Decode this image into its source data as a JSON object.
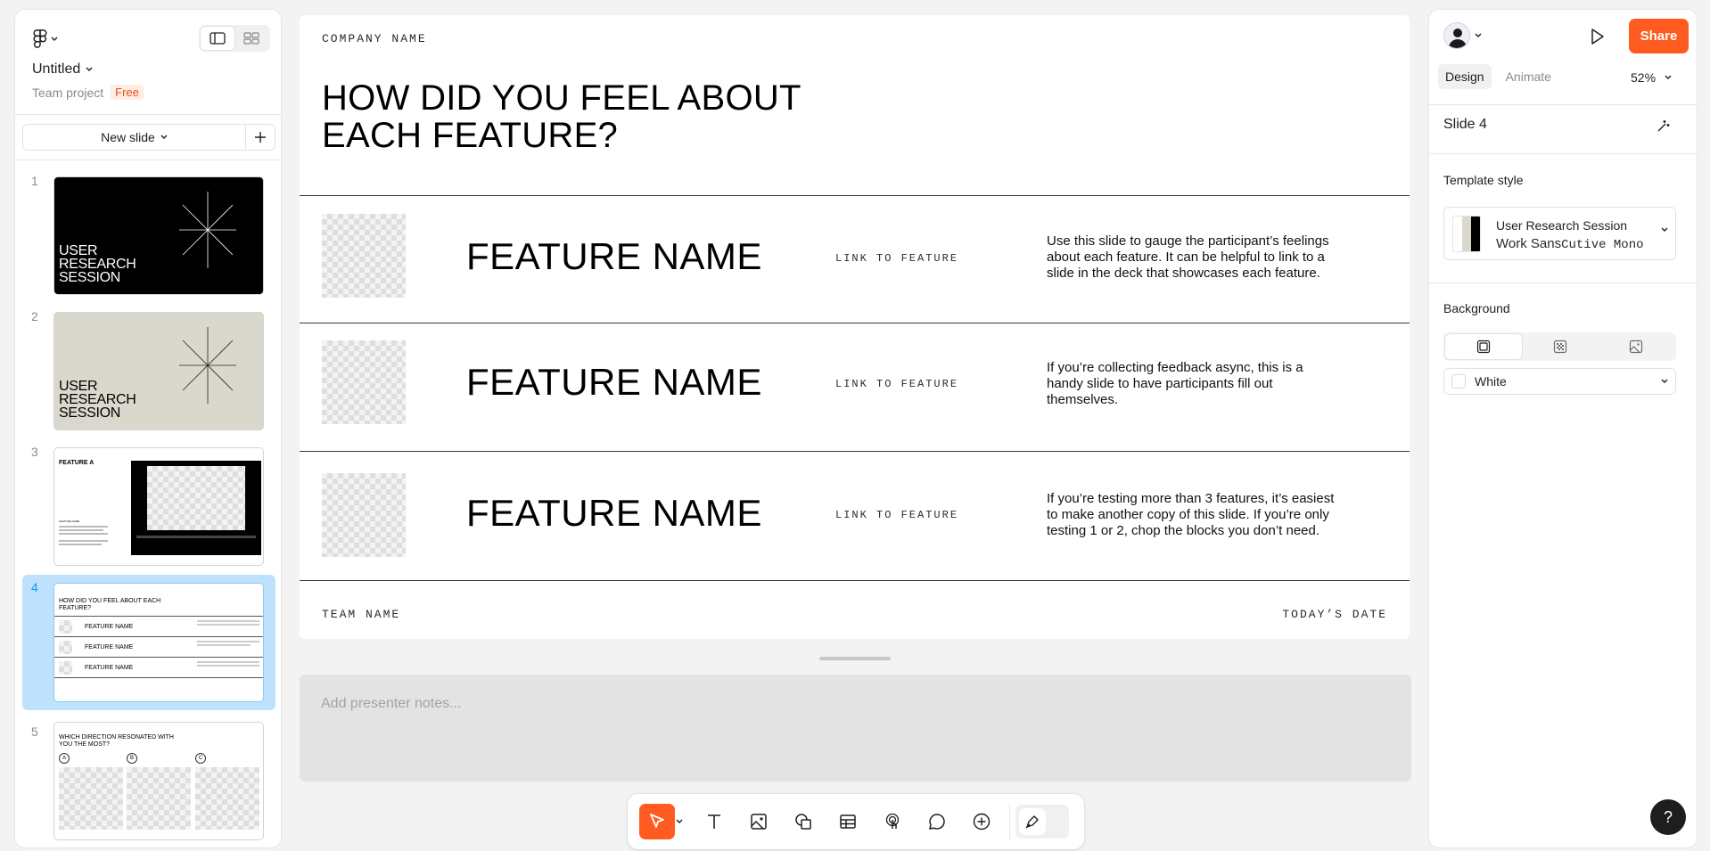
{
  "file": {
    "title": "Untitled",
    "project": "Team project",
    "plan_badge": "Free"
  },
  "left_panel": {
    "new_slide_label": "New slide",
    "selected_slide": 4,
    "thumbnails": [
      {
        "num": "1",
        "style": "dark",
        "title": "USER RESEARCH SESSION"
      },
      {
        "num": "2",
        "style": "beige",
        "title": "USER RESEARCH SESSION"
      },
      {
        "num": "3",
        "style": "feature",
        "title": "FEATURE A",
        "sub": "FEATURE NAME"
      },
      {
        "num": "4",
        "style": "table",
        "title": "HOW DID YOU FEEL ABOUT EACH FEATURE?",
        "rows": [
          "FEATURE NAME",
          "FEATURE NAME",
          "FEATURE NAME"
        ]
      },
      {
        "num": "5",
        "style": "directions",
        "title": "WHICH DIRECTION RESONATED WITH YOU THE MOST?",
        "options": [
          "A",
          "B",
          "C"
        ]
      }
    ]
  },
  "slide": {
    "company": "COMPANY NAME",
    "title_line1": "HOW DID YOU FEEL ABOUT",
    "title_line2": "EACH FEATURE?",
    "rows": [
      {
        "feature": "FEATURE NAME",
        "link": "LINK TO FEATURE",
        "desc_lines": [
          "Use this slide to gauge the participant’s feelings",
          "about each feature. It can be helpful to link to a",
          "slide in the deck that showcases each feature."
        ]
      },
      {
        "feature": "FEATURE NAME",
        "link": "LINK TO FEATURE",
        "desc_lines": [
          "If you’re collecting feedback async, this is a",
          "handy slide to have participants fill out",
          "themselves."
        ]
      },
      {
        "feature": "FEATURE NAME",
        "link": "LINK TO FEATURE",
        "desc_lines": [
          "If you’re testing more than 3 features, it’s easiest",
          "to make another copy of this slide. If you’re only",
          "testing 1 or 2, chop the blocks you don’t need."
        ]
      }
    ],
    "team": "TEAM NAME",
    "date": "TODAY’S DATE"
  },
  "notes": {
    "placeholder": "Add presenter notes..."
  },
  "toolbar": {
    "tools": [
      "move-tool",
      "text-tool",
      "image-tool",
      "shapes-tool",
      "table-tool",
      "interaction-tool",
      "comment-tool",
      "add-tool",
      "draw-tool"
    ]
  },
  "right_panel": {
    "share_label": "Share",
    "tab_design": "Design",
    "tab_animate": "Animate",
    "zoom": "52%",
    "slide_title": "Slide 4",
    "template_style_label": "Template style",
    "template_name": "User Research Session",
    "template_font_sans": "Work Sans",
    "template_font_mono": "Cutive Mono",
    "background_label": "Background",
    "background_value": "White",
    "help_label": "?"
  },
  "colors": {
    "accent": "#ff5a1f",
    "selection": "#bee2fb",
    "selection_text": "#0d99ff"
  }
}
